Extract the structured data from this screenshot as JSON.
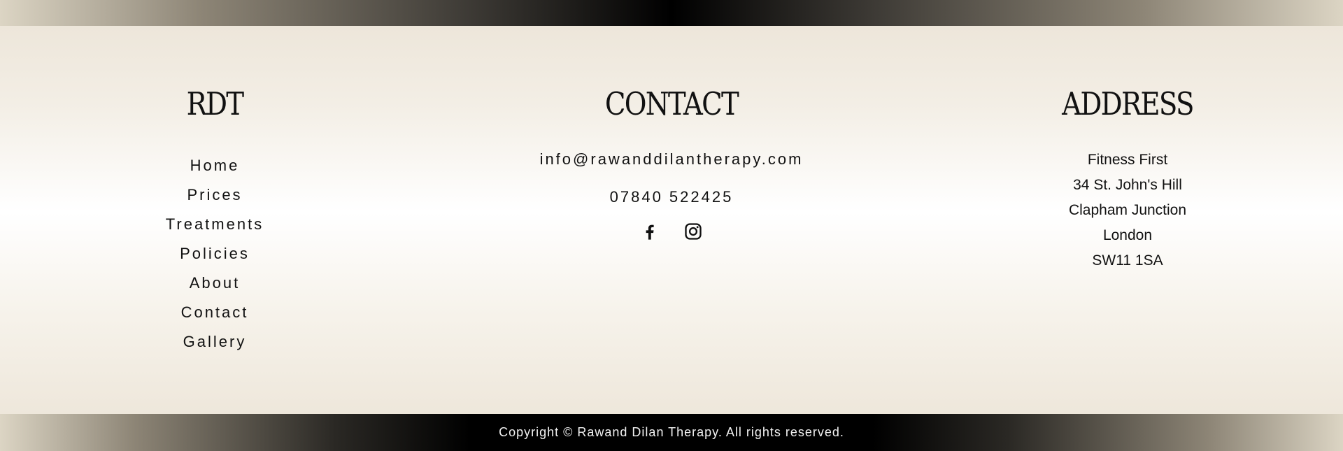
{
  "rdt": {
    "heading": "RDT",
    "nav": [
      "Home",
      "Prices",
      "Treatments",
      "Policies",
      "About",
      "Contact",
      "Gallery"
    ]
  },
  "contact": {
    "heading": "CONTACT",
    "email": "info@rawanddilantherapy.com",
    "phone": "07840 522425",
    "social": [
      {
        "icon": "facebook-icon"
      },
      {
        "icon": "instagram-icon"
      }
    ]
  },
  "address": {
    "heading": "ADDRESS",
    "lines": [
      "Fitness First",
      "34 St. John's Hill",
      "Clapham Junction",
      "London",
      "SW11 1SA"
    ]
  },
  "footer": {
    "copyright": "Copyright © Rawand Dilan Therapy. All rights reserved."
  }
}
